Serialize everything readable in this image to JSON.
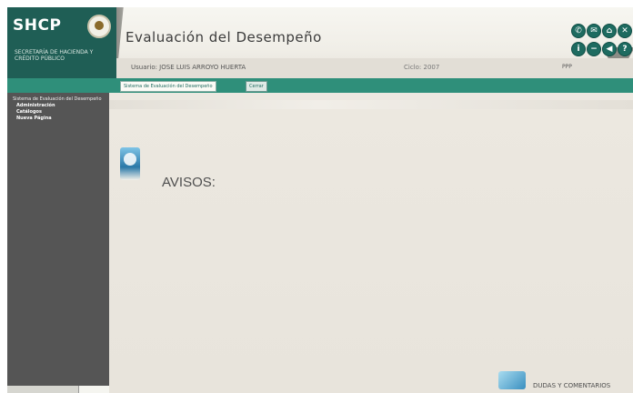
{
  "header": {
    "logo": "SHCP",
    "secretaria": "SECRETARÍA DE HACIENDA Y CRÉDITO PÚBLICO",
    "title": "Evaluación del Desempeño",
    "user_line": "Usuario: JOSE LUIS ARROYO HUERTA",
    "ciclo": "Ciclo: 2007",
    "ppp": "PPP",
    "icons": [
      "phone-icon",
      "email-icon",
      "home-icon",
      "close-icon",
      "info-icon",
      "minus-icon",
      "back-icon",
      "help-icon"
    ]
  },
  "tabs": {
    "sistema": "Sistema de Evaluación del Desempeño",
    "cerrar": "Cerrar"
  },
  "sidebar": {
    "title": "Sistema de Evaluación del Desempeño",
    "items": [
      "Administración",
      "Catálogos",
      "Nueva Página"
    ]
  },
  "main": {
    "avisos": "AVISOS:",
    "dudas": "DUDAS Y COMENTARIOS"
  }
}
